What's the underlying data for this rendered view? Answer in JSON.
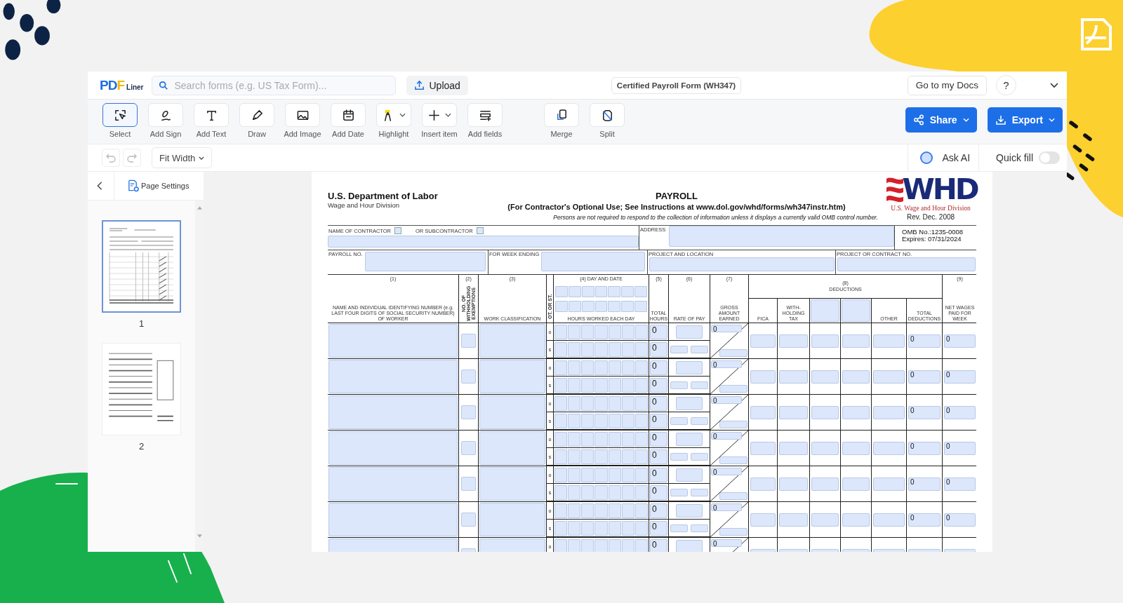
{
  "logo": {
    "mark": "PDF",
    "sub": "Liner"
  },
  "search": {
    "placeholder": "Search forms (e.g. US Tax Form)..."
  },
  "upload": "Upload",
  "document_title": "Certified Payroll Form (WH347)",
  "go_to_docs": "Go to my Docs",
  "help": "?",
  "tools": [
    {
      "kind": "select",
      "label": "Select",
      "selected": true,
      "dropdown": false
    },
    {
      "kind": "sign",
      "label": "Add Sign",
      "selected": false,
      "dropdown": false
    },
    {
      "kind": "text",
      "label": "Add Text",
      "selected": false,
      "dropdown": false
    },
    {
      "kind": "draw",
      "label": "Draw",
      "selected": false,
      "dropdown": false
    },
    {
      "kind": "image",
      "label": "Add Image",
      "selected": false,
      "dropdown": false
    },
    {
      "kind": "date",
      "label": "Add Date",
      "selected": false,
      "dropdown": false
    },
    {
      "kind": "highlight",
      "label": "Highlight",
      "selected": false,
      "dropdown": true
    },
    {
      "kind": "insert",
      "label": "Insert item",
      "selected": false,
      "dropdown": true
    },
    {
      "kind": "fields",
      "label": "Add fields",
      "selected": false,
      "dropdown": false
    }
  ],
  "page_tools": [
    {
      "kind": "merge",
      "label": "Merge",
      "selected": false,
      "dropdown": false
    },
    {
      "kind": "split",
      "label": "Split",
      "selected": false,
      "dropdown": false
    }
  ],
  "share": "Share",
  "export": "Export",
  "zoom": "Fit Width",
  "ask_ai": "Ask AI",
  "quick_fill": {
    "label": "Quick fill",
    "on": false
  },
  "sidebar": {
    "page_settings": "Page Settings",
    "pages": [
      {
        "label": "1",
        "selected": true
      },
      {
        "label": "2",
        "selected": false
      }
    ]
  },
  "form": {
    "agency": "U.S. Department of Labor",
    "division": "Wage and Hour Division",
    "title": "PAYROLL",
    "subtitle": "(For Contractor's Optional Use; See Instructions at www.dol.gov/whd/forms/wh347instr.htm)",
    "notice": "Persons are not required to respond to the collection of information unless it displays a currently valid OMB control number.",
    "seal": {
      "mark": "WHD",
      "caption": "U.S. Wage and Hour Division"
    },
    "revision": "Rev. Dec. 2008",
    "contractor": {
      "label": "NAME OF CONTRACTOR",
      "checked": false
    },
    "subcontractor": {
      "label": "OR SUBCONTRACTOR",
      "checked": false
    },
    "address_label": "ADDRESS",
    "omb": "OMB No.:1235-0008",
    "expires": "Expires: 07/31/2024",
    "payroll_no_label": "PAYROLL NO.",
    "week_ending_label": "FOR WEEK ENDING",
    "project_label": "PROJECT AND LOCATION",
    "contract_no_label": "PROJECT OR CONTRACT NO.",
    "headings": {
      "c1_num": "(1)",
      "c1": "NAME AND INDIVIDUAL IDENTIFYING NUMBER (e.g. LAST FOUR DIGITS OF SOCIAL SECURITY NUMBER) OF WORKER",
      "c2_num": "(2)",
      "c2": "NO. OF WITHHOLDING EXEMPTIONS",
      "c3_num": "(3)",
      "c3": "WORK CLASSIFICATION",
      "ot_st": "OT. OR ST.",
      "c4": "(4) DAY AND DATE",
      "c4_sub": "HOURS WORKED EACH DAY",
      "c5_num": "(5)",
      "c5": "TOTAL HOURS",
      "c6_num": "(6)",
      "c6": "RATE OF PAY",
      "c7_num": "(7)",
      "c7": "GROSS AMOUNT EARNED",
      "c8_num": "(8)",
      "c8": "DEDUCTIONS",
      "fica": "FICA",
      "withholding": "WITH-HOLDING TAX",
      "other": "OTHER",
      "total_deductions": "TOTAL DEDUCTIONS",
      "c9_num": "(9)",
      "c9": "NET WAGES PAID FOR WEEK"
    },
    "rows": [
      {
        "ot": "o",
        "st": "s",
        "ot_hours": "0",
        "st_hours": "0",
        "gross": "0",
        "total_deductions": "0",
        "net": "0"
      },
      {
        "ot": "o",
        "st": "s",
        "ot_hours": "0",
        "st_hours": "0",
        "gross": "0",
        "total_deductions": "0",
        "net": "0"
      },
      {
        "ot": "o",
        "st": "s",
        "ot_hours": "0",
        "st_hours": "0",
        "gross": "0",
        "total_deductions": "0",
        "net": "0"
      },
      {
        "ot": "o",
        "st": "s",
        "ot_hours": "0",
        "st_hours": "0",
        "gross": "0",
        "total_deductions": "0",
        "net": "0"
      },
      {
        "ot": "o",
        "st": "s",
        "ot_hours": "0",
        "st_hours": "0",
        "gross": "0",
        "total_deductions": "0",
        "net": "0"
      },
      {
        "ot": "o",
        "st": "s",
        "ot_hours": "0",
        "st_hours": "0",
        "gross": "0",
        "total_deductions": "0",
        "net": "0"
      },
      {
        "ot": "o",
        "ot_hours": "0",
        "gross": "0"
      }
    ]
  }
}
